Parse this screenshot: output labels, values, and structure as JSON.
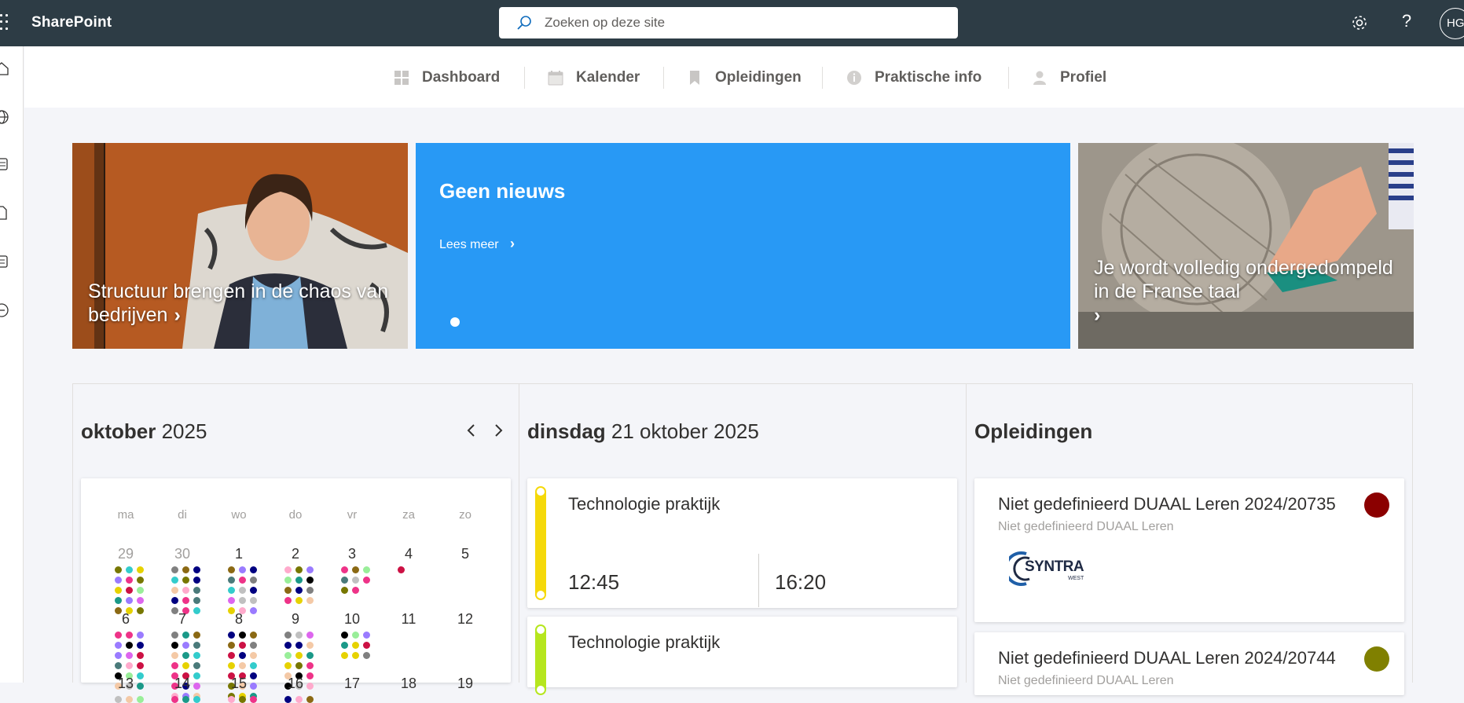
{
  "suitebar": {
    "brand": "SharePoint",
    "search_placeholder": "Zoeken op deze site",
    "help_label": "?",
    "avatar_initials": "HG"
  },
  "hubnav": {
    "items": [
      {
        "label": "Dashboard",
        "icon": "dashboard-icon"
      },
      {
        "label": "Kalender",
        "icon": "calendar-icon"
      },
      {
        "label": "Opleidingen",
        "icon": "bookmark-icon"
      },
      {
        "label": "Praktische info",
        "icon": "info-icon"
      },
      {
        "label": "Profiel",
        "icon": "person-icon"
      }
    ]
  },
  "hero": {
    "left_caption": "Structuur brengen in de chaos van bedrijven",
    "mid_title": "Geen nieuws",
    "mid_link": "Lees meer",
    "right_caption": "Je wordt volledig ondergedompeld in de Franse taal"
  },
  "calendar": {
    "month": "oktober",
    "year": "2025",
    "weekdays": [
      "ma",
      "di",
      "wo",
      "do",
      "vr",
      "za",
      "zo"
    ],
    "row1": [
      "29",
      "30",
      "1",
      "2",
      "3",
      "4",
      "5"
    ],
    "row2": [
      "6",
      "7",
      "8",
      "9",
      "10",
      "11",
      "12"
    ],
    "row3": [
      "13",
      "14",
      "15",
      "16",
      "17",
      "18",
      "19"
    ],
    "dot_colors": [
      "#f4c9a6",
      "#e6d200",
      "#000080",
      "#808080",
      "#9a7bff",
      "#c0c0c0",
      "#1a9988",
      "#ee3388",
      "#777700",
      "#33cccc",
      "#99ee99",
      "#8b6914",
      "#000000",
      "#dd66ee",
      "#cc1144",
      "#ffaacc",
      "#4a7a7a"
    ]
  },
  "day": {
    "weekday": "dinsdag",
    "date": "21 oktober 2025",
    "events": [
      {
        "title": "Technologie praktijk",
        "start": "12:45",
        "end": "16:20",
        "color": "#f5d90a"
      },
      {
        "title": "Technologie praktijk",
        "color": "#b6e61e"
      }
    ]
  },
  "opleidingen": {
    "title": "Opleidingen",
    "items": [
      {
        "title": "Niet gedefinieerd DUAAL Leren 2024/20735",
        "subtitle": "Niet gedefinieerd DUAAL Leren",
        "color": "#8b0000",
        "logo": "SYNTRA",
        "logo_sub": "WEST"
      },
      {
        "title": "Niet gedefinieerd DUAAL Leren 2024/20744",
        "subtitle": "Niet gedefinieerd DUAAL Leren",
        "color": "#808000"
      }
    ]
  }
}
